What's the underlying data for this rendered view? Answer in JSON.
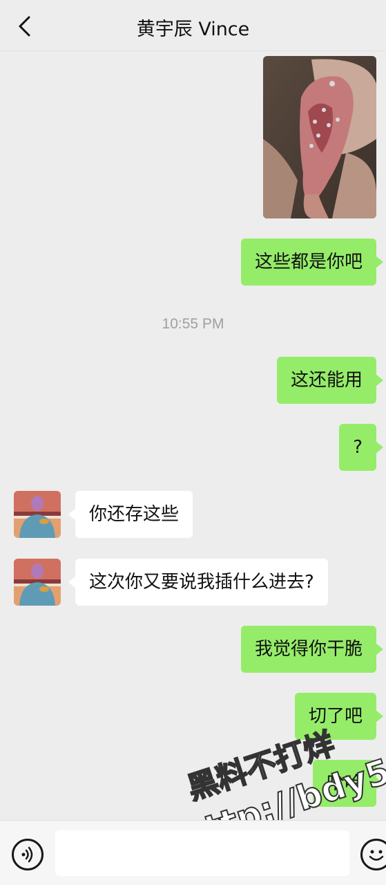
{
  "header": {
    "title": "黄宇辰 Vince",
    "back_icon": "chevron-left-icon"
  },
  "messages": [
    {
      "type": "image",
      "direction": "out"
    },
    {
      "type": "text",
      "direction": "out",
      "text": "这些都是你吧"
    },
    {
      "type": "timestamp",
      "text": "10:55 PM"
    },
    {
      "type": "text",
      "direction": "out",
      "text": "这还能用"
    },
    {
      "type": "text",
      "direction": "out",
      "text": "?"
    },
    {
      "type": "text",
      "direction": "in",
      "text": "你还存这些"
    },
    {
      "type": "text",
      "direction": "in",
      "text": "这次你又要说我插什么进去?"
    },
    {
      "type": "text",
      "direction": "out",
      "text": "我觉得你干脆"
    },
    {
      "type": "text",
      "direction": "out",
      "text": "切了吧"
    },
    {
      "type": "text",
      "direction": "out",
      "text": "哈哈"
    }
  ],
  "watermark": {
    "line1": "黑料不打烊",
    "line2": "http://bdy5.co"
  },
  "input_bar": {
    "voice_icon": "voice-icon",
    "emoji_icon": "emoji-icon",
    "input_value": ""
  },
  "colors": {
    "outgoing_bubble": "#95ec69",
    "incoming_bubble": "#ffffff",
    "background": "#ededed"
  }
}
